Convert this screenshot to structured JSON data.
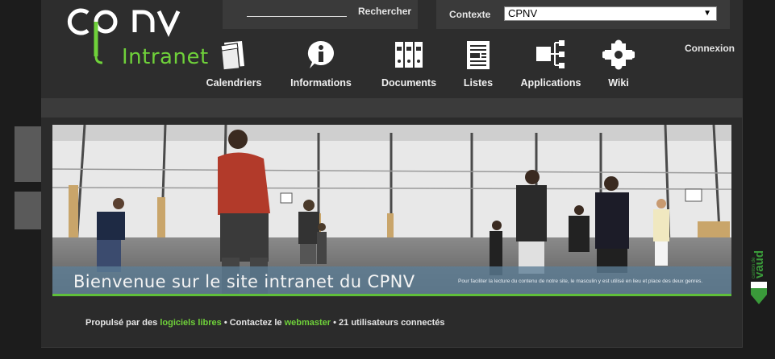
{
  "header": {
    "logo_text": "cpnv",
    "logo_subtitle": "Intranet",
    "search": {
      "button_label": "Rechercher",
      "value": ""
    },
    "context": {
      "label": "Contexte",
      "selected": "CPNV"
    },
    "login_label": "Connexion"
  },
  "nav": {
    "items": [
      {
        "label": "Calendriers",
        "icon": "calendar-icon"
      },
      {
        "label": "Informations",
        "icon": "info-icon"
      },
      {
        "label": "Documents",
        "icon": "binders-icon"
      },
      {
        "label": "Listes",
        "icon": "list-icon"
      },
      {
        "label": "Applications",
        "icon": "sitemap-icon"
      },
      {
        "label": "Wiki",
        "icon": "puzzle-icon"
      }
    ]
  },
  "banner": {
    "title": "Bienvenue sur le site intranet du CPNV",
    "note": "Pour faciliter la lecture du contenu de notre site, le masculin y est utilisé en lieu et place des deux genres."
  },
  "footer": {
    "powered_prefix": "Propulsé par des",
    "powered_link": "logiciels libres",
    "contact_prefix": "• Contactez le",
    "contact_link": "webmaster",
    "users_text": "• 21 utilisateurs connectés"
  },
  "side_logo": {
    "text": "canton de vaud"
  },
  "colors": {
    "accent_green": "#6fd13a",
    "page_bg": "#1c1c1c",
    "panel_bg": "#2d2d2d",
    "caption_blue": "#5c7d96"
  }
}
